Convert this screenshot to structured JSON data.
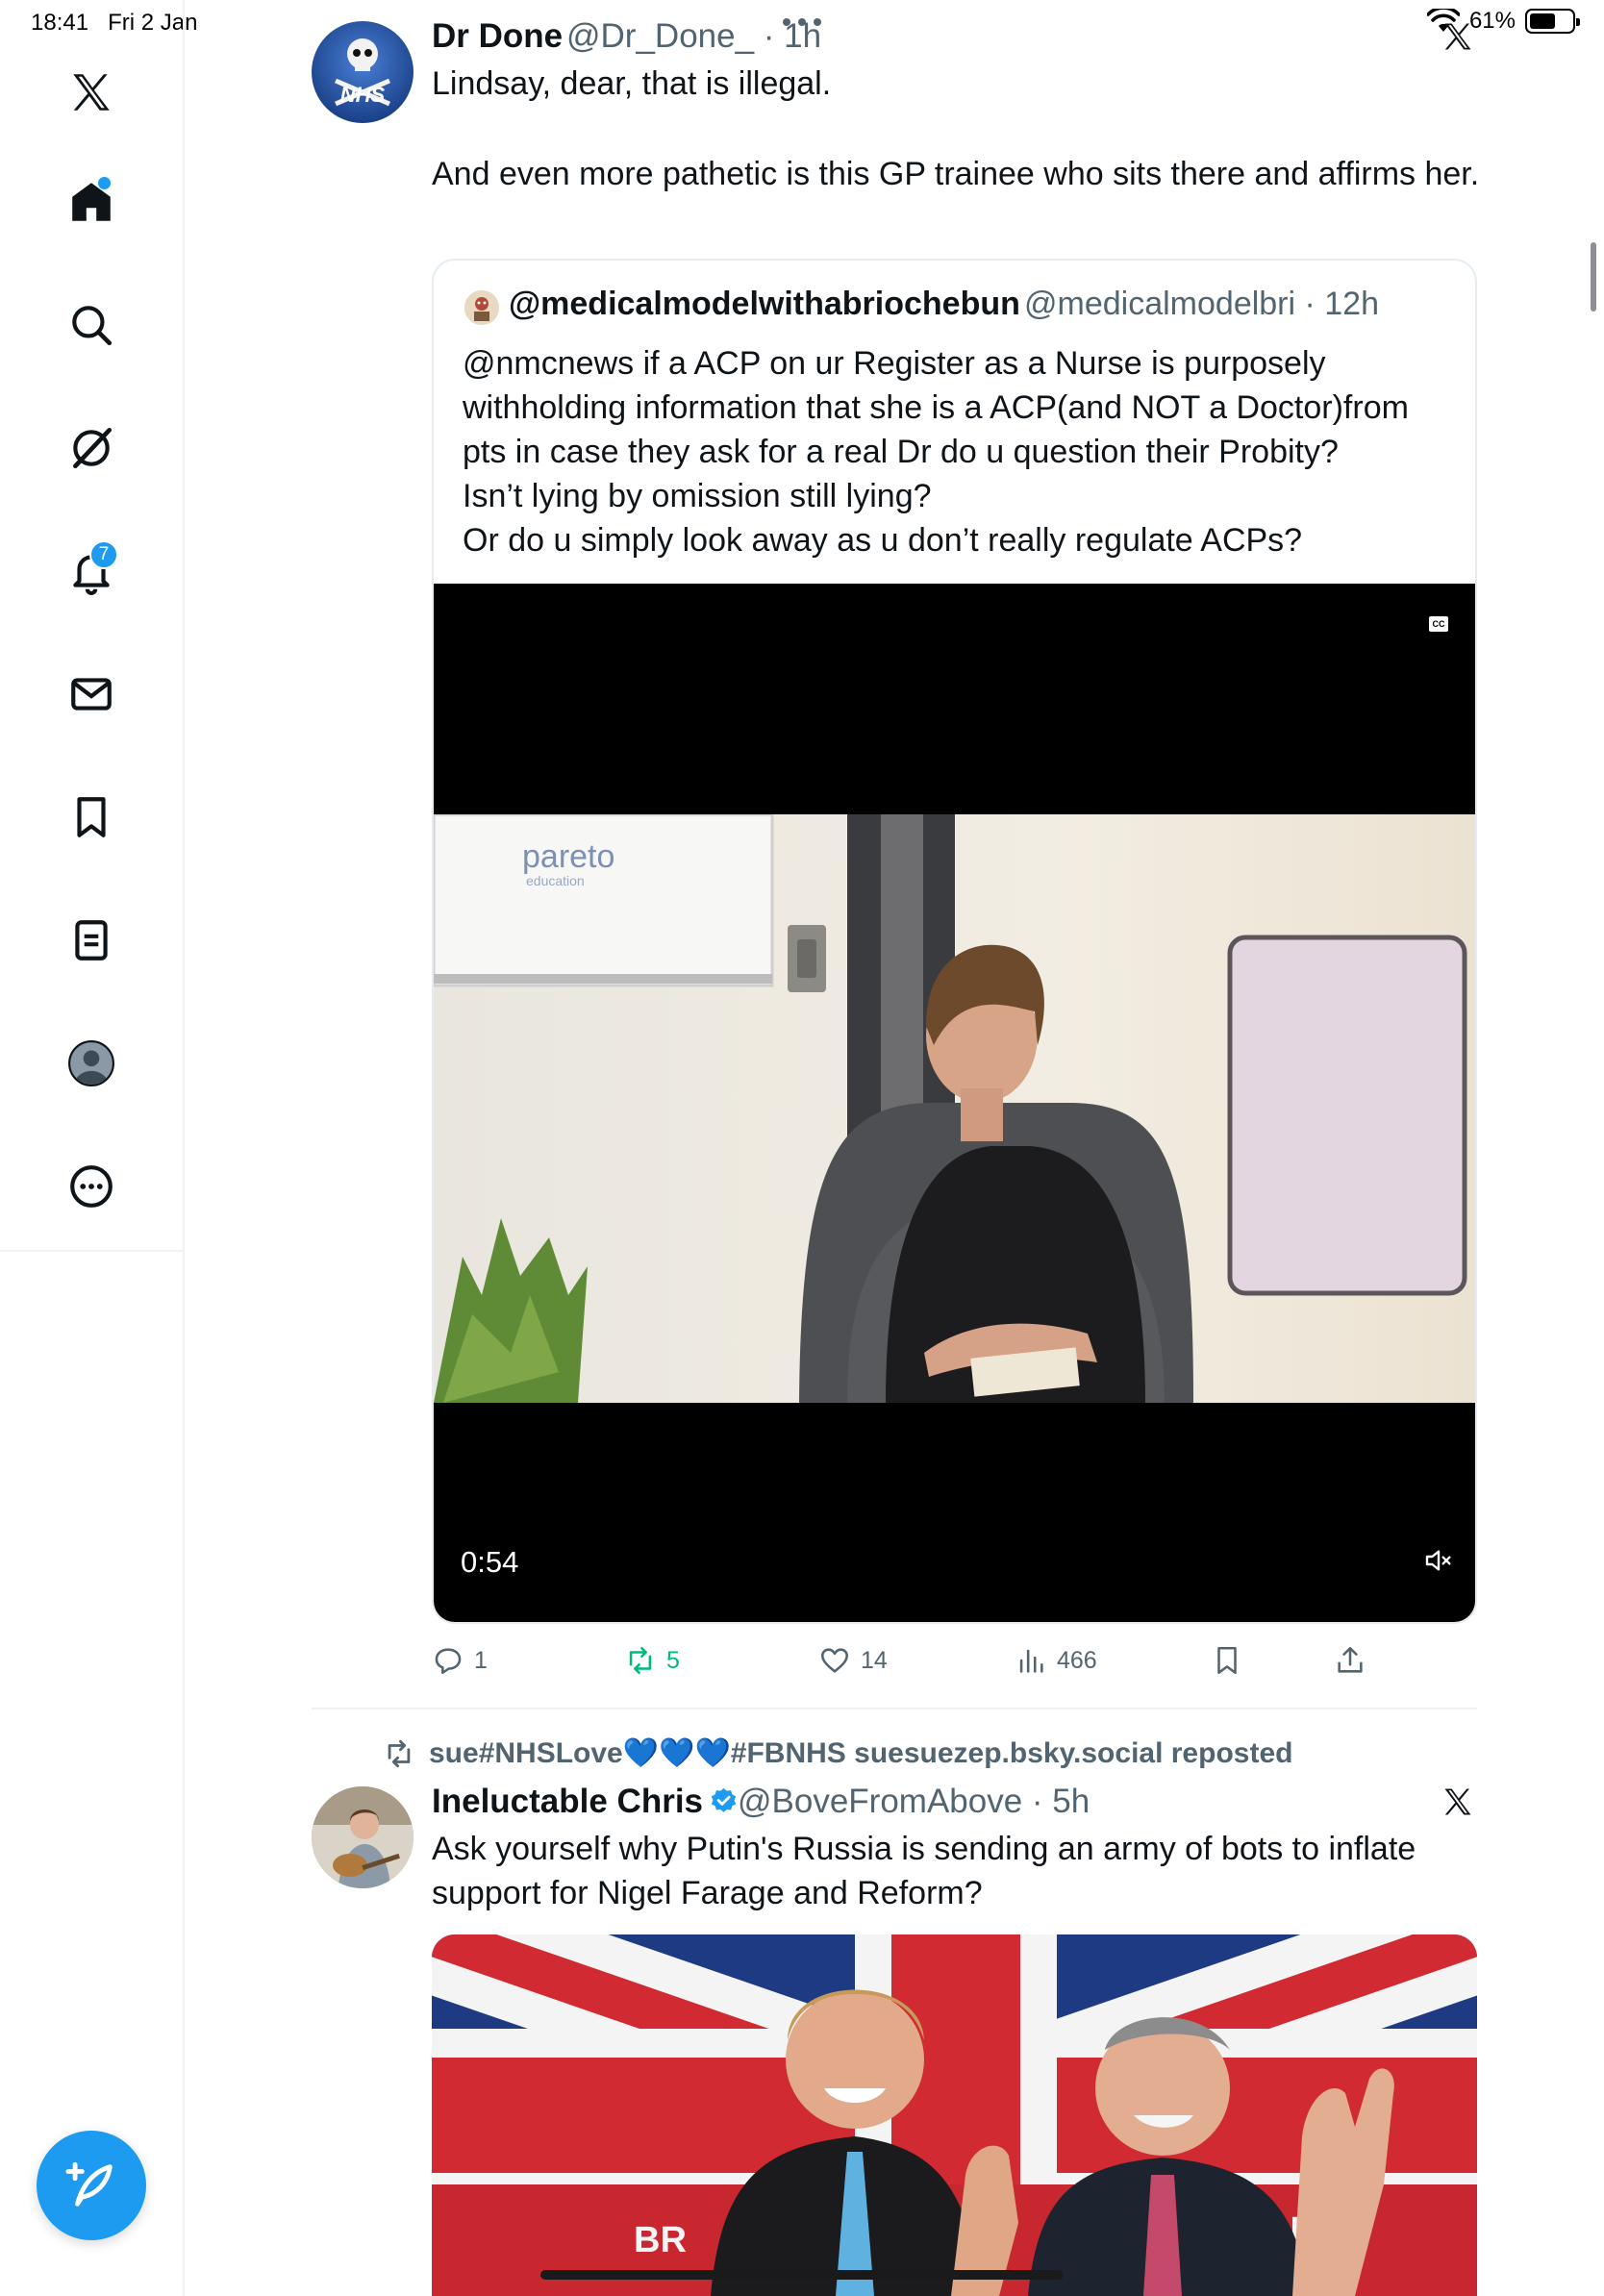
{
  "status_bar": {
    "time": "18:41",
    "date": "Fri 2 Jan",
    "battery_pct": "61%",
    "battery_level": 0.61
  },
  "sidebar": {
    "items": [
      {
        "id": "x-logo",
        "icon": "x-logo-icon"
      },
      {
        "id": "home",
        "icon": "home-icon",
        "has_dot": true
      },
      {
        "id": "search",
        "icon": "search-icon"
      },
      {
        "id": "grok",
        "icon": "grok-icon"
      },
      {
        "id": "notifications",
        "icon": "bell-icon",
        "badge": "7"
      },
      {
        "id": "messages",
        "icon": "mail-icon"
      },
      {
        "id": "bookmarks",
        "icon": "bookmark-icon"
      },
      {
        "id": "lists",
        "icon": "list-icon"
      },
      {
        "id": "profile",
        "icon": "avatar-icon"
      },
      {
        "id": "more",
        "icon": "more-circle-icon"
      }
    ],
    "accent": "#1d9bf0"
  },
  "post1": {
    "name": "Dr Done",
    "handle_time": "@Dr_Done_ · 1h",
    "avatar_text": "NHS",
    "text_line1": "Lindsay, dear, that is illegal.",
    "text_line2": "And even more pathetic is this GP trainee who sits there and affirms her.",
    "quote": {
      "name": "@medicalmodelwithabriochebun",
      "handle_time": "@medicalmodelbri · 12h",
      "text": [
        "@nmcnews if a ACP on ur Register as a Nurse is purposely",
        "withholding information that she is a ACP(and NOT a Doctor)from",
        "pts in case they ask for a real Dr do u question their Probity?",
        "Isn’t lying by omission still lying?",
        "Or do u simply look away as u don’t really regulate ACPs?"
      ],
      "video": {
        "duration": "0:54",
        "cc_label": "CC",
        "wall_logo": "pareto",
        "wall_logo_sub": "education"
      }
    },
    "actions": {
      "replies": "1",
      "reposts": "5",
      "likes": "14",
      "views": "466"
    }
  },
  "post2": {
    "repost_by": "sue#NHSLove💙💙💙#FBNHS suesuezep.bsky.social reposted",
    "name": "Ineluctable Chris",
    "handle_time": "@BoveFromAbove · 5h",
    "text_line1": "Ask yourself why Putin's Russia is sending an army of bots to inflate",
    "text_line2": "support for Nigel Farage and Reform?",
    "image_text_left": "BR",
    "image_text_right": "N"
  },
  "colors": {
    "repost_green": "#00ba7c",
    "text_secondary": "#536471",
    "verified_blue": "#1d9bf0"
  }
}
